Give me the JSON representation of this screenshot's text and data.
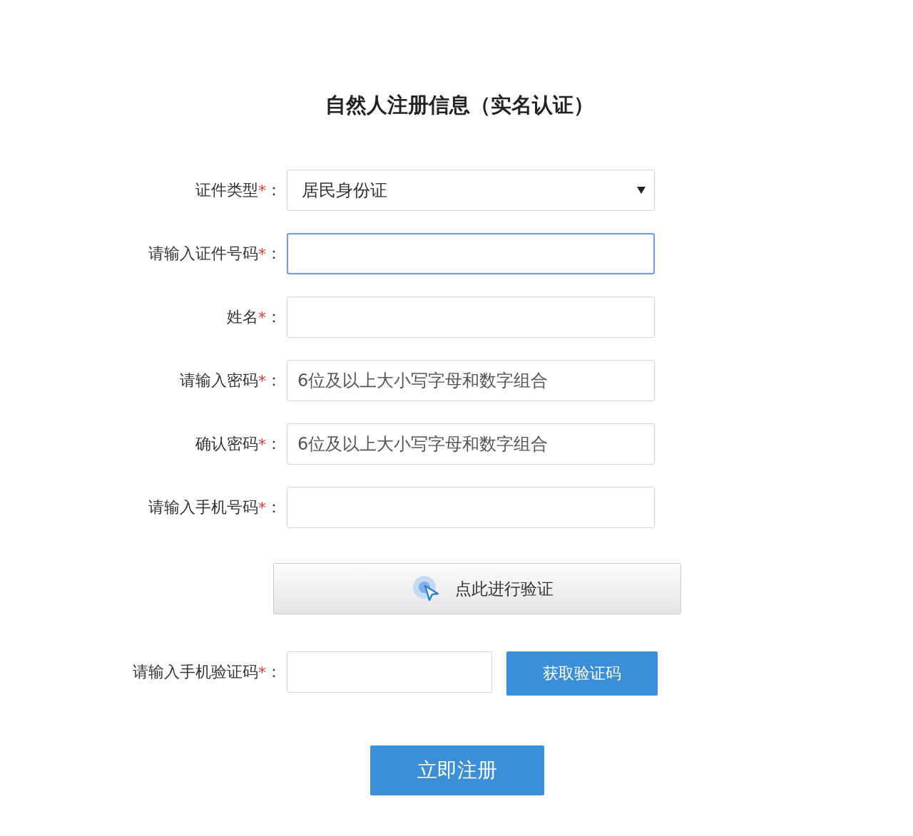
{
  "title": "自然人注册信息（实名认证）",
  "fields": [
    {
      "kind": "select",
      "label": "证件类型",
      "mark": "*",
      "colon": "：",
      "value": "居民身份证",
      "focused": false
    },
    {
      "kind": "input",
      "label": "请输入证件号码",
      "mark": "*",
      "colon": "：",
      "focused": true
    },
    {
      "kind": "input",
      "label": "姓名",
      "mark": "*",
      "colon": "：",
      "focused": false
    },
    {
      "kind": "input",
      "label": "请输入密码",
      "mark": "*",
      "colon": "：",
      "placeholder": "6位及以上大小写字母和数字组合",
      "focused": false
    },
    {
      "kind": "input",
      "label": "确认密码",
      "mark": "*",
      "colon": "：",
      "placeholder": "6位及以上大小写字母和数字组合",
      "focused": false
    },
    {
      "kind": "input",
      "label": "请输入手机号码",
      "mark": "*",
      "colon": "：",
      "focused": false
    }
  ],
  "verify_button": {
    "label": "点此进行验证"
  },
  "sms_code": {
    "label": "请输入手机验证码",
    "mark": "*",
    "colon": "：",
    "button": "获取验证码"
  },
  "submit_button": {
    "label": "立即注册"
  }
}
